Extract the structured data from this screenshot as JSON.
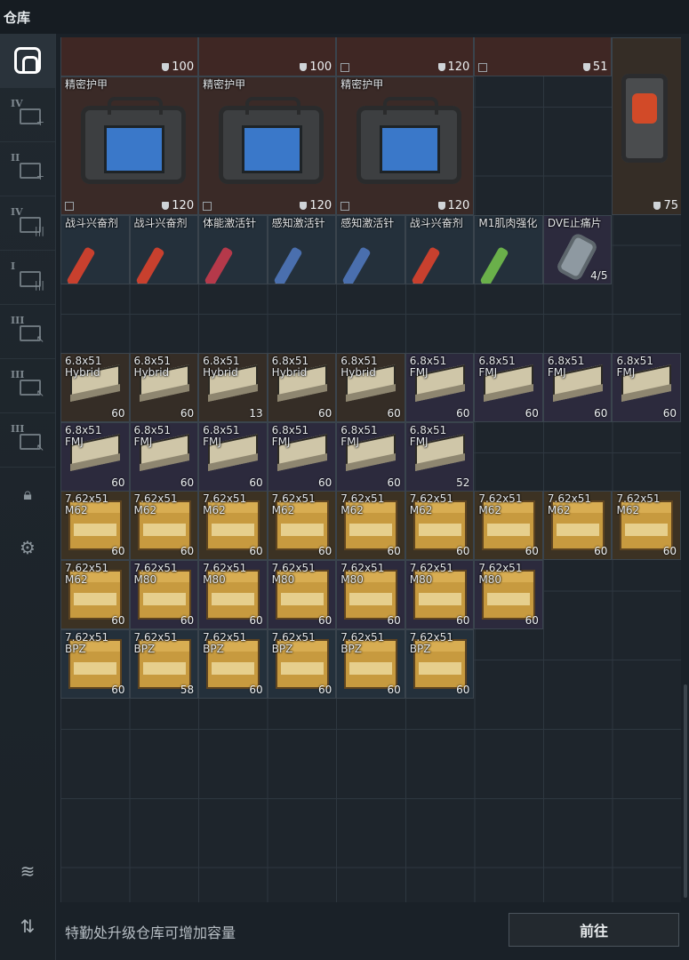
{
  "title": "仓库",
  "sidebar": [
    "home",
    "upgrade-iv",
    "upgrade-ii",
    "folder-iv",
    "folder-i",
    "tier-iii-a",
    "tier-iii-b",
    "tier-iii-c",
    "lock",
    "settings",
    "layers",
    "transfer"
  ],
  "rows": {
    "top": [
      {
        "dur": "100",
        "bg": "bg-red2"
      },
      {
        "dur": "100",
        "bg": "bg-red2"
      },
      {
        "dur": "120",
        "bg": "bg-red2"
      },
      {
        "dur": "51",
        "bg": "bg-red2"
      }
    ],
    "armor": [
      {
        "name": "精密护甲",
        "dur": "120"
      },
      {
        "name": "精密护甲",
        "dur": "120"
      },
      {
        "name": "精密护甲",
        "dur": "120"
      }
    ],
    "case_dur": "75",
    "meds": [
      {
        "name": "战斗兴奋剂",
        "color": "#c8402e"
      },
      {
        "name": "战斗兴奋剂",
        "color": "#c8402e"
      },
      {
        "name": "体能激活针",
        "color": "#b5394a"
      },
      {
        "name": "感知激活针",
        "color": "#4a6fae"
      },
      {
        "name": "感知激活针",
        "color": "#4a6fae"
      },
      {
        "name": "战斗兴奋剂",
        "color": "#c8402e"
      },
      {
        "name": "M1肌肉强化",
        "color": "#6ab04a"
      },
      {
        "name": "DVE止痛片",
        "color": "",
        "count": "4/5"
      }
    ],
    "ammo68_a": [
      {
        "name": "6.8x51\nHybrid",
        "count": "60"
      },
      {
        "name": "6.8x51\nHybrid",
        "count": "60"
      },
      {
        "name": "6.8x51\nHybrid",
        "count": "13"
      },
      {
        "name": "6.8x51\nHybrid",
        "count": "60"
      },
      {
        "name": "6.8x51\nHybrid",
        "count": "60"
      },
      {
        "name": "6.8x51\nFMJ",
        "count": "60"
      },
      {
        "name": "6.8x51\nFMJ",
        "count": "60"
      },
      {
        "name": "6.8x51\nFMJ",
        "count": "60"
      },
      {
        "name": "6.8x51\nFMJ",
        "count": "60"
      }
    ],
    "ammo68_b": [
      {
        "name": "6.8x51\nFMJ",
        "count": "60"
      },
      {
        "name": "6.8x51\nFMJ",
        "count": "60"
      },
      {
        "name": "6.8x51\nFMJ",
        "count": "60"
      },
      {
        "name": "6.8x51\nFMJ",
        "count": "60"
      },
      {
        "name": "6.8x51\nFMJ",
        "count": "60"
      },
      {
        "name": "6.8x51\nFMJ",
        "count": "52"
      }
    ],
    "ammo762_a": [
      {
        "name": "7.62x51\nM62",
        "count": "60"
      },
      {
        "name": "7.62x51\nM62",
        "count": "60"
      },
      {
        "name": "7.62x51\nM62",
        "count": "60"
      },
      {
        "name": "7.62x51\nM62",
        "count": "60"
      },
      {
        "name": "7.62x51\nM62",
        "count": "60"
      },
      {
        "name": "7.62x51\nM62",
        "count": "60"
      },
      {
        "name": "7.62x51\nM62",
        "count": "60"
      },
      {
        "name": "7.62x51\nM62",
        "count": "60"
      },
      {
        "name": "7.62x51\nM62",
        "count": "60"
      }
    ],
    "ammo762_b": [
      {
        "name": "7.62x51\nM62",
        "count": "60"
      },
      {
        "name": "7.62x51\nM80",
        "count": "60"
      },
      {
        "name": "7.62x51\nM80",
        "count": "60"
      },
      {
        "name": "7.62x51\nM80",
        "count": "60"
      },
      {
        "name": "7.62x51\nM80",
        "count": "60"
      },
      {
        "name": "7.62x51\nM80",
        "count": "60"
      },
      {
        "name": "7.62x51\nM80",
        "count": "60"
      }
    ],
    "ammo762_c": [
      {
        "name": "7.62x51\nBPZ",
        "count": "60"
      },
      {
        "name": "7.62x51\nBPZ",
        "count": "58"
      },
      {
        "name": "7.62x51\nBPZ",
        "count": "60"
      },
      {
        "name": "7.62x51\nBPZ",
        "count": "60"
      },
      {
        "name": "7.62x51\nBPZ",
        "count": "60"
      },
      {
        "name": "7.62x51\nBPZ",
        "count": "60"
      }
    ]
  },
  "sidebar_tiers": {
    "upgrade_iv": "IV",
    "upgrade_ii": "II",
    "folder_iv": "IV",
    "folder_i": "I",
    "t3a": "III",
    "t3b": "III",
    "t3c": "III"
  },
  "footer": {
    "hint": "特勤处升级仓库可增加容量",
    "button": "前往"
  }
}
